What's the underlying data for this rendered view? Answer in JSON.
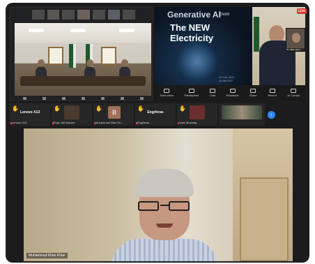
{
  "slide": {
    "title_line1": "Generative AI",
    "brand": "Zoom",
    "title_line2": "The NEW Electricity",
    "date_lines": [
      "21 Feb 2024",
      "10 AM EST"
    ]
  },
  "badges": {
    "live": "Live"
  },
  "pip_label": "Dr. Nasir Jamil",
  "toolbar": {
    "items": [
      {
        "label": "Start video",
        "icon": "video-icon"
      },
      {
        "label": "Participants",
        "icon": "participants-icon"
      },
      {
        "label": "Chat",
        "icon": "chat-icon"
      },
      {
        "label": "Reactions",
        "icon": "reactions-icon"
      },
      {
        "label": "Share",
        "icon": "share-icon"
      },
      {
        "label": "Record",
        "icon": "record-icon"
      },
      {
        "label": "AI Compa",
        "icon": "ai-companion-icon"
      }
    ]
  },
  "participants": [
    {
      "center_name": "Lenovo X13",
      "bottom_name": "Lenovo X13",
      "hand": true
    },
    {
      "center_name": "",
      "bottom_name": "Engr. Atif Wazeer",
      "hand": true,
      "video": true
    },
    {
      "center_name": "",
      "bottom_name": "Muhammad Bilal Sh...",
      "hand": true,
      "avatar": "B"
    },
    {
      "center_name": "Engrferas",
      "bottom_name": "Engrferas",
      "hand": true
    },
    {
      "center_name": "",
      "bottom_name": "Yasir Mushtaq",
      "hand": true,
      "video": true
    },
    {
      "center_name": "",
      "bottom_name": "",
      "hand": false,
      "video": true
    }
  ],
  "main_speaker": {
    "name": "Muhammad Khan Khan"
  },
  "colors": {
    "accent": "#2d8cff",
    "live": "#e53935",
    "hand": "#f4c430"
  }
}
